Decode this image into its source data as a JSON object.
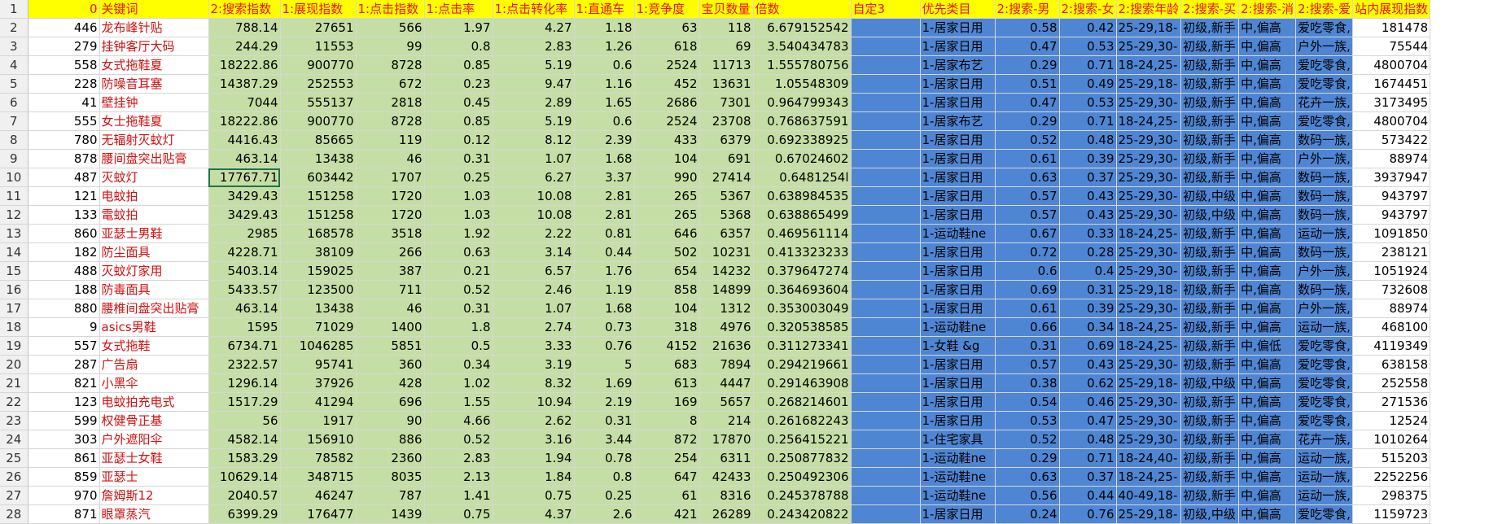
{
  "colors": {
    "header_bg": "#ffff00",
    "header_text": "#e8141a",
    "green_band": "#c5dea5",
    "blue_band": "#4f86d4",
    "selection": "#217346"
  },
  "row_numbers": [
    "1",
    "2",
    "3",
    "4",
    "5",
    "6",
    "7",
    "8",
    "9",
    "10",
    "11",
    "12",
    "13",
    "14",
    "15",
    "16",
    "17",
    "18",
    "19",
    "20",
    "21",
    "22",
    "23",
    "24",
    "25",
    "26",
    "27",
    "28"
  ],
  "headers": [
    "0",
    "关键词",
    "2:搜索指数",
    "1:展现指数",
    "1:点击指数",
    "1:点击率",
    "1:点击转化率",
    "1:直通车",
    "1:竞争度",
    "宝贝数量",
    "倍数",
    "自定3",
    "优先类目",
    "2:搜索-男",
    "2:搜索-女",
    "2:搜索年龄",
    "2:搜索-买",
    "2:搜索-消",
    "2:搜索-爱",
    "站内展现指数"
  ],
  "rows": [
    [
      "446",
      "龙布峰针贴",
      "788.14",
      "27651",
      "566",
      "1.97",
      "4.27",
      "1.18",
      "63",
      "118",
      "6.679152542",
      "",
      "1-居家日用",
      "0.58",
      "0.42",
      "25-29,18-",
      "初级,新手",
      "中,偏高",
      "爱吃零食,",
      "181478"
    ],
    [
      "279",
      "挂钟客厅大码",
      "244.29",
      "11553",
      "99",
      "0.8",
      "2.83",
      "1.26",
      "618",
      "69",
      "3.540434783",
      "",
      "1-居家日用",
      "0.47",
      "0.53",
      "25-29,30-",
      "初级,新手",
      "中,偏高",
      "户外一族,",
      "75544"
    ],
    [
      "558",
      "女式拖鞋夏",
      "18222.86",
      "900770",
      "8728",
      "0.85",
      "5.19",
      "0.6",
      "2524",
      "11713",
      "1.555780756",
      "",
      "1-居家布艺",
      "0.29",
      "0.71",
      "18-24,25-",
      "初级,新手",
      "中,偏高",
      "爱吃零食,",
      "4800704"
    ],
    [
      "228",
      "防噪音耳塞",
      "14387.29",
      "252553",
      "672",
      "0.23",
      "9.47",
      "1.16",
      "452",
      "13631",
      "1.05548309",
      "",
      "1-居家日用",
      "0.51",
      "0.49",
      "25-29,18-",
      "初级,新手",
      "中,偏高",
      "爱吃零食,",
      "1674451"
    ],
    [
      "41",
      "壁挂钟",
      "7044",
      "555137",
      "2818",
      "0.45",
      "2.89",
      "1.65",
      "2686",
      "7301",
      "0.964799343",
      "",
      "1-居家日用",
      "0.47",
      "0.53",
      "25-29,30-",
      "初级,新手",
      "中,偏高",
      "花卉一族,",
      "3173495"
    ],
    [
      "555",
      "女士拖鞋夏",
      "18222.86",
      "900770",
      "8728",
      "0.85",
      "5.19",
      "0.6",
      "2524",
      "23708",
      "0.768637591",
      "",
      "1-居家布艺",
      "0.29",
      "0.71",
      "18-24,25-",
      "初级,新手",
      "中,偏高",
      "爱吃零食,",
      "4800704"
    ],
    [
      "780",
      "无辐射灭蚊灯",
      "4416.43",
      "85665",
      "119",
      "0.12",
      "8.12",
      "2.39",
      "433",
      "6379",
      "0.692338925",
      "",
      "1-居家日用",
      "0.52",
      "0.48",
      "25-29,30-",
      "初级,新手",
      "中,偏高",
      "数码一族,",
      "573422"
    ],
    [
      "878",
      "腰间盘突出贴膏",
      "463.14",
      "13438",
      "46",
      "0.31",
      "1.07",
      "1.68",
      "104",
      "691",
      "0.67024602",
      "",
      "1-居家日用",
      "0.61",
      "0.39",
      "25-29,30-",
      "初级,新手",
      "中,偏高",
      "户外一族,",
      "88974"
    ],
    [
      "487",
      "灭蚊灯",
      "17767.71",
      "603442",
      "1707",
      "0.25",
      "6.27",
      "3.37",
      "990",
      "27414",
      "0.6481254l",
      "",
      "1-居家日用",
      "0.63",
      "0.37",
      "25-29,30-",
      "初级,新手",
      "中,偏高",
      "数码一族,",
      "3937947"
    ],
    [
      "121",
      "电蚊拍",
      "3429.43",
      "151258",
      "1720",
      "1.03",
      "10.08",
      "2.81",
      "265",
      "5367",
      "0.638984535",
      "",
      "1-居家日用",
      "0.57",
      "0.43",
      "25-29,30-",
      "初级,中级",
      "中,偏高",
      "数码一族,",
      "943797"
    ],
    [
      "133",
      "電蚊拍",
      "3429.43",
      "151258",
      "1720",
      "1.03",
      "10.08",
      "2.81",
      "265",
      "5368",
      "0.638865499",
      "",
      "1-居家日用",
      "0.57",
      "0.43",
      "25-29,30-",
      "初级,中级",
      "中,偏高",
      "数码一族,",
      "943797"
    ],
    [
      "860",
      "亚瑟士男鞋",
      "2985",
      "168578",
      "3518",
      "1.92",
      "2.22",
      "0.81",
      "646",
      "6357",
      "0.469561114",
      "",
      "1-运动鞋ne",
      "0.67",
      "0.33",
      "18-24,25-",
      "初级,新手",
      "中,偏高",
      "运动一族,",
      "1091850"
    ],
    [
      "182",
      "防尘面具",
      "4228.71",
      "38109",
      "266",
      "0.63",
      "3.14",
      "0.44",
      "502",
      "10231",
      "0.413323233",
      "",
      "1-居家日用",
      "0.72",
      "0.28",
      "25-29,30-",
      "初级,新手",
      "中,偏高",
      "数码一族,",
      "238121"
    ],
    [
      "488",
      "灭蚊灯家用",
      "5403.14",
      "159025",
      "387",
      "0.21",
      "6.57",
      "1.76",
      "654",
      "14232",
      "0.379647274",
      "",
      "1-居家日用",
      "0.6",
      "0.4",
      "25-29,30-",
      "初级,新手",
      "中,偏高",
      "户外一族,",
      "1051924"
    ],
    [
      "188",
      "防毒面具",
      "5433.57",
      "123500",
      "711",
      "0.52",
      "2.46",
      "1.19",
      "858",
      "14899",
      "0.364693604",
      "",
      "1-居家日用",
      "0.69",
      "0.31",
      "25-29,18-",
      "初级,新手",
      "中,偏高",
      "数码一族,",
      "732608"
    ],
    [
      "880",
      "腰椎间盘突出贴膏",
      "463.14",
      "13438",
      "46",
      "0.31",
      "1.07",
      "1.68",
      "104",
      "1312",
      "0.353003049",
      "",
      "1-居家日用",
      "0.61",
      "0.39",
      "25-29,30-",
      "初级,新手",
      "中,偏高",
      "户外一族,",
      "88974"
    ],
    [
      "9",
      "asics男鞋",
      "1595",
      "71029",
      "1400",
      "1.8",
      "2.74",
      "0.73",
      "318",
      "4976",
      "0.320538585",
      "",
      "1-运动鞋ne",
      "0.66",
      "0.34",
      "18-24,25-",
      "初级,新手",
      "中,偏高",
      "运动一族,",
      "468100"
    ],
    [
      "557",
      "女式拖鞋",
      "6734.71",
      "1046285",
      "5851",
      "0.5",
      "3.33",
      "0.76",
      "4152",
      "21636",
      "0.311273341",
      "",
      "1-女鞋 &g",
      "0.31",
      "0.69",
      "18-24,25-",
      "初级,新手",
      "中,偏低",
      "爱吃零食,",
      "4119349"
    ],
    [
      "287",
      "广告扇",
      "2322.57",
      "95741",
      "360",
      "0.34",
      "3.19",
      "5",
      "683",
      "7894",
      "0.294219661",
      "",
      "1-居家日用",
      "0.57",
      "0.43",
      "25-29,30-",
      "初级,新手",
      "中,偏高",
      "爱吃零食,",
      "638158"
    ],
    [
      "821",
      "小黑伞",
      "1296.14",
      "37926",
      "428",
      "1.02",
      "8.32",
      "1.69",
      "613",
      "4447",
      "0.291463908",
      "",
      "1-居家日用",
      "0.38",
      "0.62",
      "25-29,18-",
      "初级,中级",
      "中,偏高",
      "爱吃零食,",
      "252558"
    ],
    [
      "123",
      "电蚊拍充电式",
      "1517.29",
      "41294",
      "696",
      "1.55",
      "10.94",
      "2.19",
      "169",
      "5657",
      "0.268214601",
      "",
      "1-居家日用",
      "0.54",
      "0.46",
      "25-29,30-",
      "初级,新手",
      "中,偏高",
      "爱吃零食,",
      "271536"
    ],
    [
      "599",
      "权健骨正基",
      "56",
      "1917",
      "90",
      "4.66",
      "2.62",
      "0.31",
      "8",
      "214",
      "0.261682243",
      "",
      "1-居家日用",
      "0.53",
      "0.47",
      "25-29,30-",
      "初级,新手",
      "中,偏高",
      "爱吃零食,",
      "12524"
    ],
    [
      "303",
      "户外遮阳伞",
      "4582.14",
      "156910",
      "886",
      "0.52",
      "3.16",
      "3.44",
      "872",
      "17870",
      "0.256415221",
      "",
      "1-住宅家具",
      "0.52",
      "0.48",
      "25-29,30-",
      "初级,新手",
      "中,偏高",
      "花卉一族,",
      "1010264"
    ],
    [
      "861",
      "亚瑟士女鞋",
      "1583.29",
      "78582",
      "2360",
      "2.83",
      "1.94",
      "0.78",
      "254",
      "6311",
      "0.250877832",
      "",
      "1-运动鞋ne",
      "0.29",
      "0.71",
      "18-24,40-",
      "初级,新手",
      "中,偏高",
      "运动一族,",
      "515203"
    ],
    [
      "859",
      "亚瑟士",
      "10629.14",
      "348715",
      "8035",
      "2.13",
      "1.84",
      "0.8",
      "647",
      "42433",
      "0.250492306",
      "",
      "1-运动鞋ne",
      "0.63",
      "0.37",
      "18-24,25-",
      "初级,新手",
      "中,偏高",
      "运动一族,",
      "2252256"
    ],
    [
      "970",
      "詹姆斯12",
      "2040.57",
      "46247",
      "787",
      "1.41",
      "0.75",
      "0.25",
      "61",
      "8316",
      "0.245378788",
      "",
      "1-运动鞋ne",
      "0.56",
      "0.44",
      "40-49,18-",
      "初级,新手",
      "中,偏高",
      "运动一族,",
      "298375"
    ],
    [
      "871",
      "眼罩蒸汽",
      "6399.29",
      "176477",
      "1439",
      "0.75",
      "4.37",
      "2.6",
      "421",
      "26289",
      "0.243420822",
      "",
      "1-居家日用",
      "0.24",
      "0.76",
      "25-29,18-",
      "初级,中级",
      "中,偏高",
      "爱吃零食,",
      "1159723"
    ]
  ]
}
